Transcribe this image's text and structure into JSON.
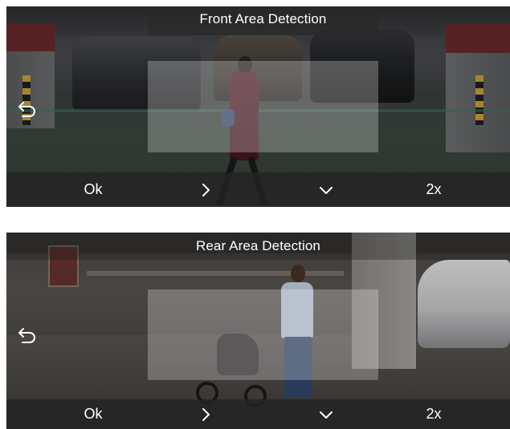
{
  "panels": [
    {
      "title": "Front Area Detection",
      "toolbar": {
        "ok_label": "Ok",
        "zoom_label": "2x"
      },
      "icons": {
        "back": "back-arrow-icon",
        "next": "chevron-right-icon",
        "down": "chevron-down-icon"
      }
    },
    {
      "title": "Rear Area Detection",
      "toolbar": {
        "ok_label": "Ok",
        "zoom_label": "2x"
      },
      "icons": {
        "back": "back-arrow-icon",
        "next": "chevron-right-icon",
        "down": "chevron-down-icon"
      }
    }
  ],
  "colors": {
    "toolbar_bg": "#232323",
    "text": "#ffffff",
    "roi_fill": "#ffffff"
  }
}
